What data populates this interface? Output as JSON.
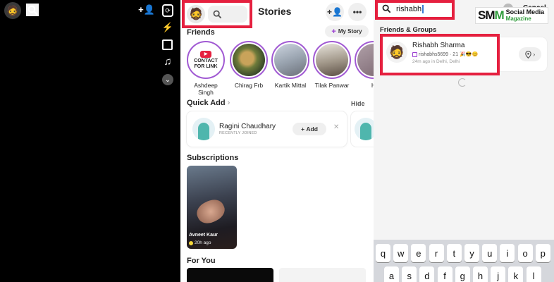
{
  "camera": {
    "avatar_icon": "bitmoji-avatar",
    "search_icon": "search-icon",
    "add_friend_icon": "add-friend-icon",
    "tools": [
      "flip-camera-icon",
      "flash-off-icon",
      "film-icon",
      "music-icon",
      "more-chevron-icon"
    ]
  },
  "stories": {
    "title": "Stories",
    "friends_label": "Friends",
    "my_story_label": "My Story",
    "contact_line1": "CONTACT",
    "contact_line2": "FOR LINK",
    "friends": [
      {
        "name": "Ashdeep Singh"
      },
      {
        "name": "Chirag Frb"
      },
      {
        "name": "Kartik Mittal"
      },
      {
        "name": "Tilak Panwar"
      },
      {
        "name": "H"
      }
    ],
    "quick_add": {
      "title": "Quick Add",
      "hide_label": "Hide",
      "name": "Ragini Chaudhary",
      "subtitle": "RECENTLY JOINED",
      "add_label": "Add",
      "dismiss": "✕"
    },
    "subscriptions": {
      "title": "Subscriptions",
      "card_name": "Avneet Kaur",
      "card_time": "20h ago"
    },
    "for_you_title": "For You"
  },
  "search": {
    "query": "rishabh",
    "cancel_label": "Cancel",
    "clear": "✕",
    "section_title": "Friends & Groups",
    "result": {
      "name": "Rishabh Sharma",
      "username": "rishabhs5699",
      "streak": "· 21 🎉😎😊",
      "location": "24m ago in Delhi, Delhi"
    },
    "keyboard_row1": [
      "q",
      "w",
      "e",
      "r",
      "t",
      "y",
      "u",
      "i",
      "o",
      "p"
    ],
    "keyboard_row2": [
      "a",
      "s",
      "d",
      "f",
      "g",
      "h",
      "j",
      "k",
      "l"
    ]
  },
  "watermark": {
    "letters_a": "SM",
    "letters_b": "M",
    "line1": "Social Media",
    "line2": "Magazine"
  },
  "colors": {
    "highlight": "#e5203f",
    "story_ring": "#a15ad3",
    "brand_green": "#2e9b3a"
  }
}
